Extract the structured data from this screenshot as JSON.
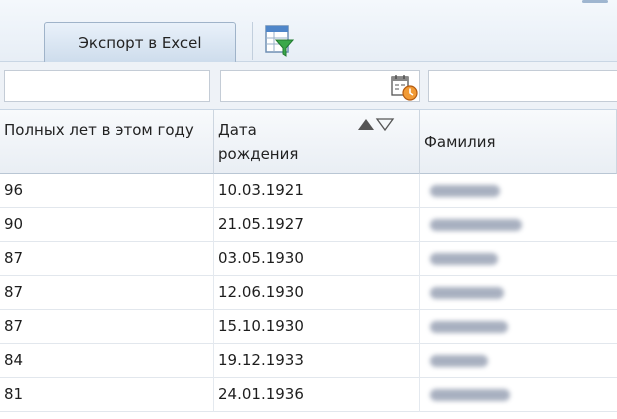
{
  "toolbar": {
    "export_label": "Экспорт в Excel",
    "filter_icon": "filter-excel-icon"
  },
  "filters": {
    "age_value": "",
    "birthdate_value": "",
    "surname_value": "",
    "date_icon": "calendar-clock-icon"
  },
  "table": {
    "columns": [
      {
        "label": "Полных лет в этом году"
      },
      {
        "label": "Дата рождения",
        "sort_icons": "sort-asc-desc-icon"
      },
      {
        "label": "Фамилия"
      }
    ],
    "rows": [
      {
        "age": "96",
        "birthdate": "10.03.1921"
      },
      {
        "age": "90",
        "birthdate": "21.05.1927"
      },
      {
        "age": "87",
        "birthdate": "03.05.1930"
      },
      {
        "age": "87",
        "birthdate": "12.06.1930"
      },
      {
        "age": "87",
        "birthdate": "15.10.1930"
      },
      {
        "age": "84",
        "birthdate": "19.12.1933"
      },
      {
        "age": "81",
        "birthdate": "24.01.1936"
      }
    ]
  },
  "colors": {
    "accent_underline": "#9ad11d",
    "header_bg": "#e9eef4",
    "button_bg": "#cddcec"
  }
}
